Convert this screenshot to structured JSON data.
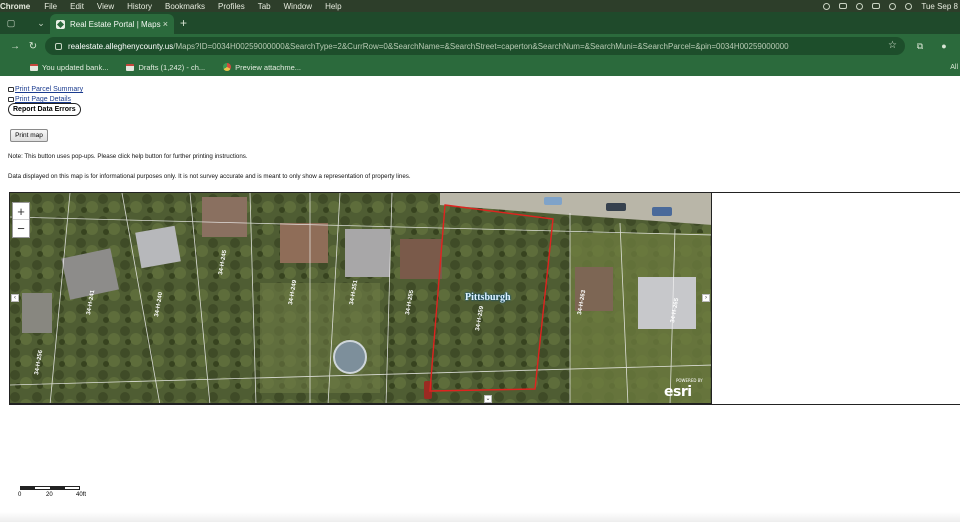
{
  "menubar": {
    "app_name": "Chrome",
    "items": [
      "File",
      "Edit",
      "View",
      "History",
      "Bookmarks",
      "Profiles",
      "Tab",
      "Window",
      "Help"
    ],
    "clock": "Tue Sep 8"
  },
  "browser": {
    "tab_title": "Real Estate Portal | Maps",
    "url_host": "realestate.alleghenycounty.us",
    "url_path": "/Maps?ID=0034H00259000000&SearchType=2&CurrRow=0&SearchName=&SearchStreet=caperton&SearchNum=&SearchMuni=&SearchParcel=&pin=0034H00259000000",
    "bookmarks": [
      {
        "label": "You updated bank...",
        "icon": "gmail-icon"
      },
      {
        "label": "Drafts (1,242) - ch...",
        "icon": "gmail-icon"
      },
      {
        "label": "Preview attachme...",
        "icon": "chrome-icon"
      }
    ],
    "all_bookmarks_label": "All"
  },
  "page": {
    "print_parcel_summary": "Print Parcel Summary",
    "print_page_details": "Print Page Details",
    "report_data_errors": "Report Data Errors",
    "print_map": "Print map",
    "note_popups": "Note: This button uses pop-ups. Please click help button for further printing instructions.",
    "note_disclaimer": "Data displayed on this map is for informational purposes only. It is not survey accurate and is meant to only show a representation of property lines."
  },
  "map": {
    "zoom_in": "+",
    "zoom_out": "−",
    "town_label": "Pittsburgh",
    "esri": "esri",
    "esri_powered": "POWERED BY",
    "selected_parcel_color": "#e0231f",
    "parcel_labels": [
      "34-H-259",
      "34-H-263",
      "34-H-265",
      "34-H-255",
      "34-H-251",
      "34-H-249",
      "34-H-245",
      "34-H-240",
      "34-H-241",
      "34-H-256",
      "34-H-230",
      "34-H-125"
    ],
    "scale_labels": [
      "0",
      "20",
      "40ft"
    ]
  }
}
